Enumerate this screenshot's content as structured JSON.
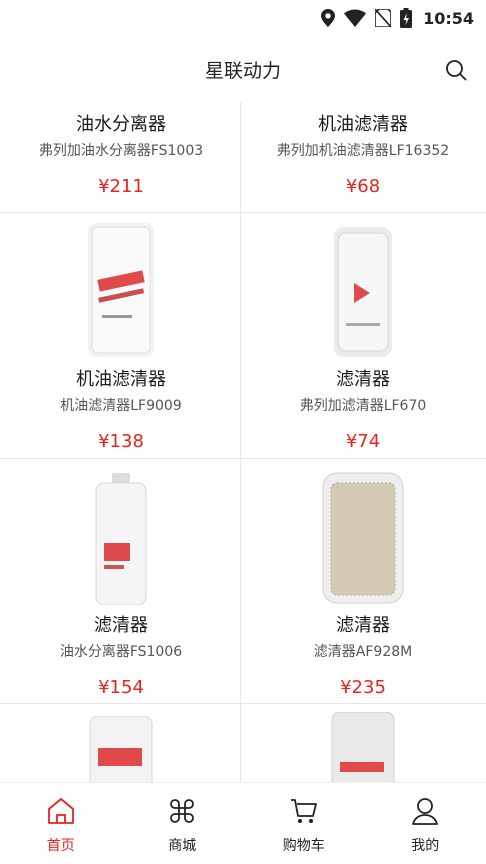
{
  "status_bar": {
    "time": "10:54"
  },
  "header": {
    "title": "星联动力"
  },
  "products": [
    {
      "name": "油水分离器",
      "desc": "弗列加油水分离器FS1003",
      "price": "¥211",
      "image": "none"
    },
    {
      "name": "机油滤清器",
      "desc": "弗列加机油滤清器LF16352",
      "price": "¥68",
      "image": "none"
    },
    {
      "name": "机油滤清器",
      "desc": "机油滤清器LF9009",
      "price": "¥138",
      "image": "filter-image"
    },
    {
      "name": "滤清器",
      "desc": "弗列加滤清器LF670",
      "price": "¥74",
      "image": "filter-image"
    },
    {
      "name": "滤清器",
      "desc": "油水分离器FS1006",
      "price": "¥154",
      "image": "filter-image"
    },
    {
      "name": "滤清器",
      "desc": "滤清器AF928M",
      "price": "¥235",
      "image": "air-filter-image"
    }
  ],
  "tabs": [
    {
      "label": "首页",
      "icon": "home-icon",
      "active": true
    },
    {
      "label": "商城",
      "icon": "mall-icon",
      "active": false
    },
    {
      "label": "购物车",
      "icon": "cart-icon",
      "active": false
    },
    {
      "label": "我的",
      "icon": "profile-icon",
      "active": false
    }
  ],
  "colors": {
    "accent": "#e8231c",
    "divider": "#e6e6e6"
  }
}
